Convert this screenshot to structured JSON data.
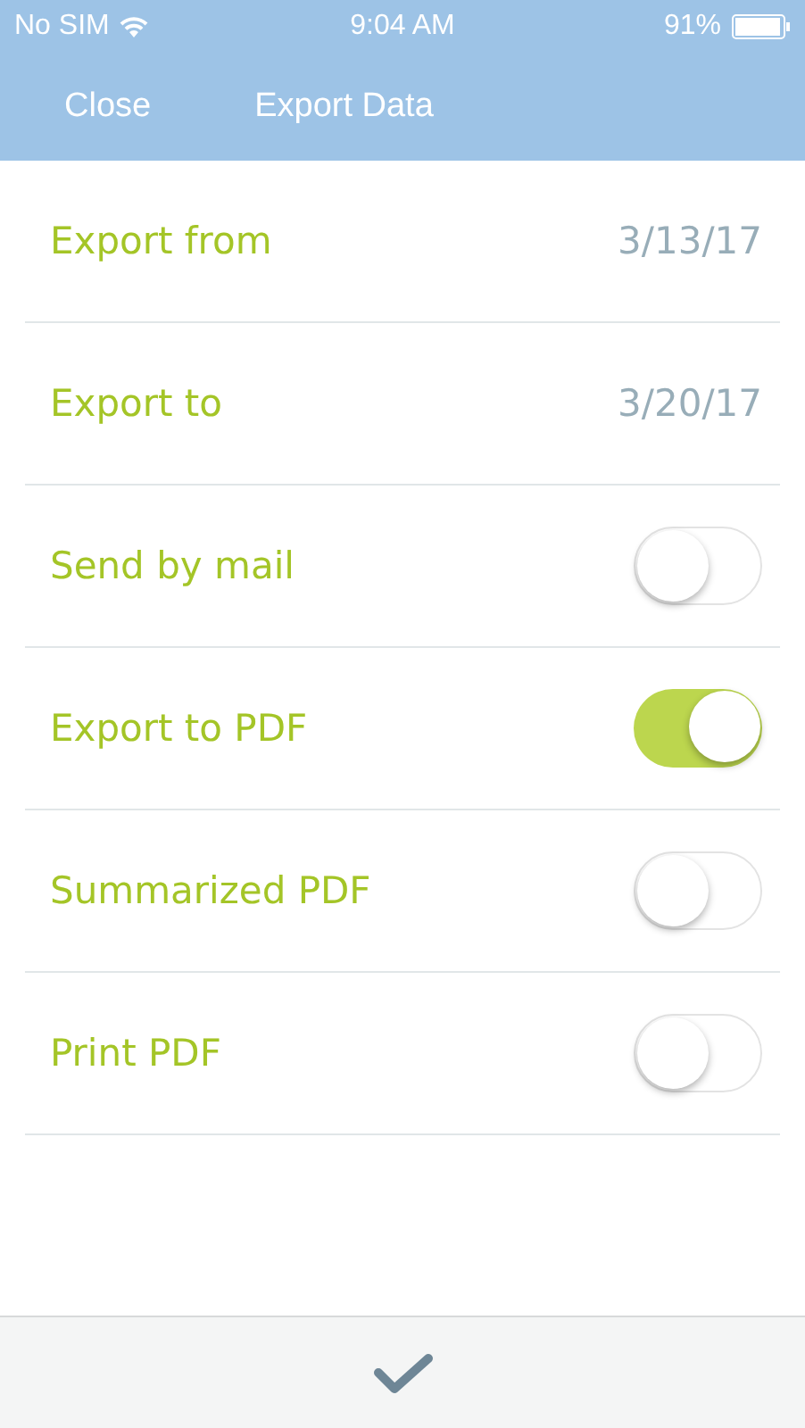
{
  "status_bar": {
    "carrier": "No SIM",
    "time": "9:04 AM",
    "battery": "91%"
  },
  "nav": {
    "close": "Close",
    "title": "Export Data"
  },
  "rows": [
    {
      "kind": "date",
      "label": "Export from",
      "value": "3/13/17"
    },
    {
      "kind": "date",
      "label": "Export to",
      "value": "3/20/17"
    },
    {
      "kind": "toggle",
      "label": "Send by mail",
      "on": false
    },
    {
      "kind": "toggle",
      "label": "Export to PDF",
      "on": true
    },
    {
      "kind": "toggle",
      "label": "Summarized PDF",
      "on": false
    },
    {
      "kind": "toggle",
      "label": "Print PDF",
      "on": false
    }
  ]
}
